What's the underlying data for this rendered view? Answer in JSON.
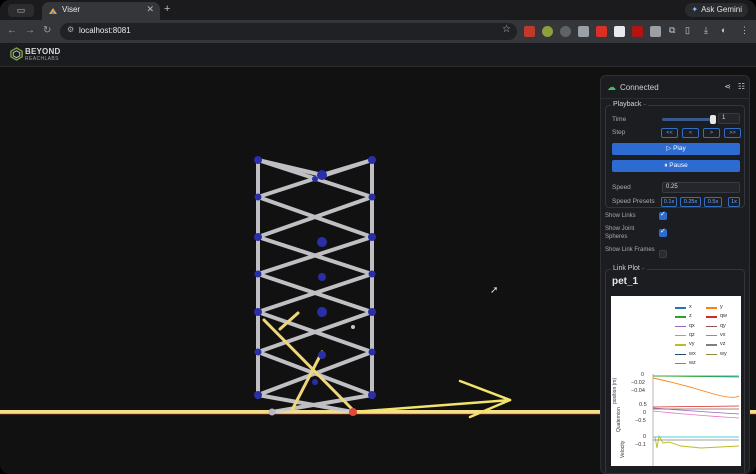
{
  "browser": {
    "tab_title": "Viser",
    "new_tab": "+",
    "gemini_label": "Ask Gemini",
    "url": "localhost:8081",
    "tab_close": "✕"
  },
  "app": {
    "logo_line1": "BEYOND",
    "logo_line2": "REACHLABS"
  },
  "panel": {
    "connection": "Connected",
    "playback": {
      "title": "Playback",
      "time_label": "Time",
      "time_value": "1",
      "time_fraction": 0.95,
      "step_label": "Step",
      "step_buttons": [
        "<<",
        "<",
        ">",
        ">>"
      ],
      "play_label": "▷ Play",
      "pause_label": "⏸ Pause",
      "speed_label": "Speed",
      "speed_value": "0.25",
      "presets_label": "Speed Presets",
      "presets": [
        "0.1x",
        "0.25x",
        "0.5x",
        "1x"
      ]
    },
    "toggles": [
      {
        "label": "Show Links",
        "checked": true
      },
      {
        "label": "Show Joint Spheres",
        "checked": true
      },
      {
        "label": "Show Link Frames",
        "checked": false
      }
    ],
    "link_plot": {
      "title": "Link Plot",
      "name": "pet_1",
      "legend": [
        {
          "name": "x",
          "color": "#1f77b4"
        },
        {
          "name": "y",
          "color": "#ff7f0e"
        },
        {
          "name": "z",
          "color": "#2ca02c"
        },
        {
          "name": "qw",
          "color": "#d62728"
        },
        {
          "name": "qx",
          "color": "#9467bd"
        },
        {
          "name": "qy",
          "color": "#8c564b"
        },
        {
          "name": "qz",
          "color": "#e377c2"
        },
        {
          "name": "vx",
          "color": "#17becf"
        },
        {
          "name": "vy",
          "color": "#bcbd22"
        },
        {
          "name": "vz",
          "color": "#7f7f7f"
        },
        {
          "name": "wx",
          "color": "#1f4e79"
        },
        {
          "name": "wy",
          "color": "#8c8c3c"
        },
        {
          "name": "wz",
          "color": "#b07a3a"
        }
      ],
      "axis_title_1": "position (m)",
      "axis_title_2": "Quaternion",
      "axis_title_3": "Velocity",
      "ticks_1": [
        "0",
        "−0.02",
        "−0.04"
      ],
      "ticks_2": [
        "0.5",
        "0",
        "−0.5"
      ],
      "ticks_3": [
        "0",
        "−0.1"
      ]
    }
  }
}
